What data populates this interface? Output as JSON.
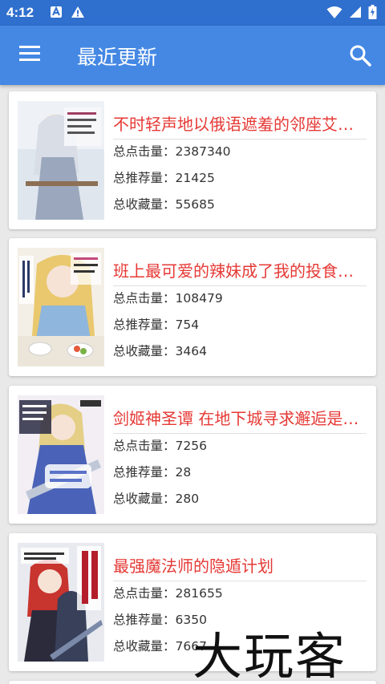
{
  "status_bar": {
    "time": "4:12"
  },
  "app_bar": {
    "title": "最近更新",
    "menu_icon": "menu-icon",
    "search_icon": "search-icon"
  },
  "labels": {
    "clicks": "总点击量：",
    "recommends": "总推荐量：",
    "favorites": "总收藏量："
  },
  "books": [
    {
      "title": "不时轻声地以俄语遮羞的邻座艾莉同学",
      "clicks": "2387340",
      "recommends": "21425",
      "favorites": "55685"
    },
    {
      "title": "班上最可爱的辣妹成了我的投食对象",
      "clicks": "108479",
      "recommends": "754",
      "favorites": "3464"
    },
    {
      "title": "剑姬神圣谭 在地下城寻求邂逅是否搞错了什么外传",
      "clicks": "7256",
      "recommends": "28",
      "favorites": "280"
    },
    {
      "title": "最强魔法师的隐遁计划",
      "clicks": "281655",
      "recommends": "6350",
      "favorites": "7667"
    }
  ],
  "watermark": "大玩客",
  "colors": {
    "app_bar": "#4488e4",
    "status_bar": "#2f6fce",
    "title_text": "#e53935",
    "background": "#e9e9e9"
  }
}
